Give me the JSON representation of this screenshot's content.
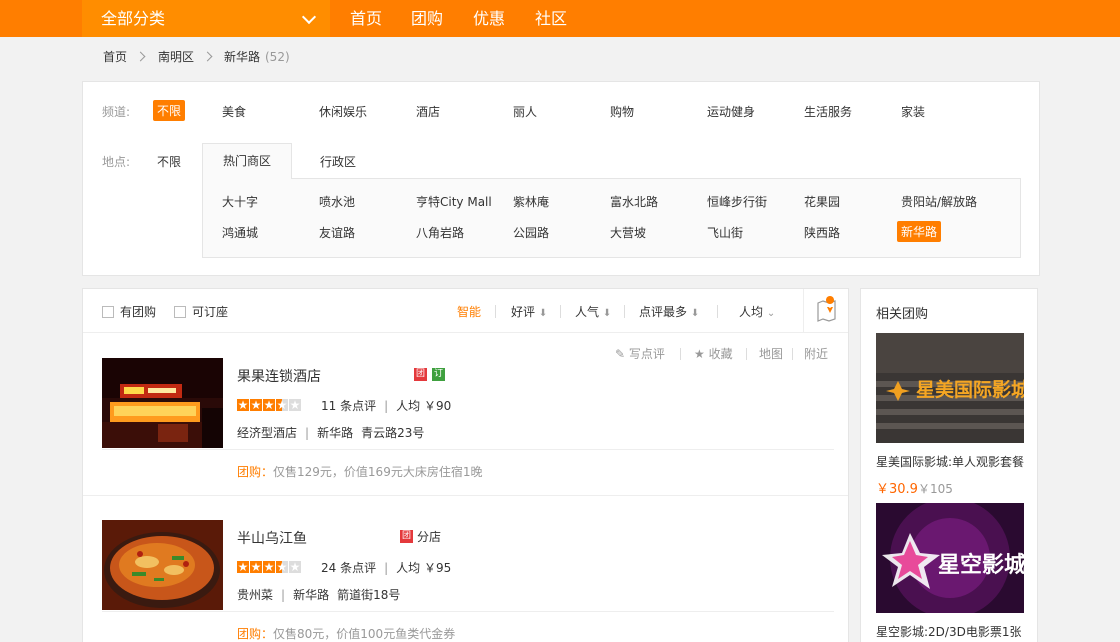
{
  "nav": {
    "category_label": "全部分类",
    "links": [
      "首页",
      "团购",
      "优惠",
      "社区"
    ]
  },
  "breadcrumb": {
    "items": [
      "首页",
      "南明区",
      "新华路"
    ],
    "count": "(52)"
  },
  "filter": {
    "channel_label": "频道:",
    "channels": [
      "不限",
      "美食",
      "休闲娱乐",
      "酒店",
      "丽人",
      "购物",
      "运动健身",
      "生活服务",
      "家装"
    ],
    "location_label": "地点:",
    "location_unlimited": "不限",
    "tab_hot": "热门商区",
    "tab_admin": "行政区",
    "areas_row1": [
      "大十字",
      "喷水池",
      "亨特City Mall",
      "紫林庵",
      "富水北路",
      "恒峰步行街",
      "花果园",
      "贵阳站/解放路"
    ],
    "areas_row2": [
      "鸿通城",
      "友谊路",
      "八角岩路",
      "公园路",
      "大营坡",
      "飞山街",
      "陕西路",
      "新华路"
    ]
  },
  "sortbar": {
    "has_groupon": "有团购",
    "bookable": "可订座",
    "sorts": [
      "智能",
      "好评",
      "人气",
      "点评最多",
      "人均"
    ]
  },
  "shops": [
    {
      "name": "果果连锁酒店",
      "tags": [
        "团",
        "订"
      ],
      "reviews": "11 条点评",
      "avg": "人均 ￥90",
      "category": "经济型酒店",
      "area": "新华路",
      "address": "青云路23号",
      "deal_tag": "团购：",
      "deal_text": "仅售129元，价值169元大床房住宿1晚",
      "rating": 3.5
    },
    {
      "name": "半山乌江鱼",
      "tags": [
        "团"
      ],
      "branch": "分店",
      "reviews": "24 条点评",
      "avg": "人均 ￥95",
      "category": "贵州菜",
      "area": "新华路",
      "address": "箭道街18号",
      "deal_tag": "团购：",
      "deal_text": "仅售80元，价值100元鱼类代金券",
      "rating": 3.5
    }
  ],
  "shop_actions": [
    "写点评",
    "收藏",
    "地图",
    "附近"
  ],
  "side": {
    "title": "相关团购",
    "deals": [
      {
        "name": "星美国际影城:单人观影套餐",
        "price": "￥30.9",
        "old_price": "￥105",
        "logo_text": "星美国际影城"
      },
      {
        "name": "星空影城:2D/3D电影票1张",
        "logo_text": "星空影城"
      }
    ]
  },
  "colors": {
    "accent": "#ff7e00",
    "groupon_tag": "#e4393c",
    "book_tag": "#3fa03f"
  }
}
